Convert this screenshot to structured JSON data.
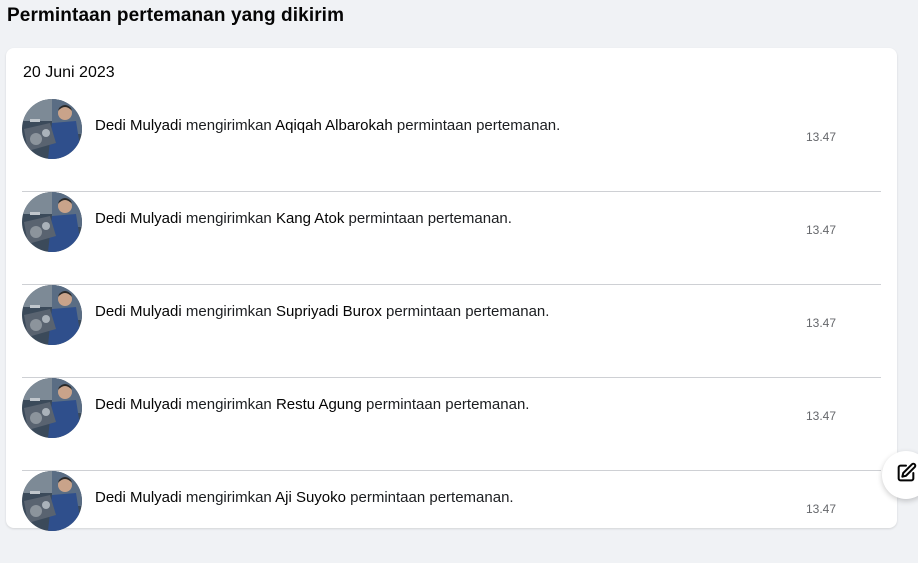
{
  "page": {
    "title": "Permintaan pertemanan yang dikirim"
  },
  "section": {
    "date": "20 Juni 2023"
  },
  "requests": [
    {
      "sender": "Dedi Mulyadi",
      "verb": "mengirimkan",
      "recipient": "Aqiqah Albarokah",
      "suffix": "permintaan pertemanan.",
      "time": "13.47"
    },
    {
      "sender": "Dedi Mulyadi",
      "verb": "mengirimkan",
      "recipient": "Kang Atok",
      "suffix": "permintaan pertemanan.",
      "time": "13.47"
    },
    {
      "sender": "Dedi Mulyadi",
      "verb": "mengirimkan",
      "recipient": "Supriyadi Burox",
      "suffix": "permintaan pertemanan.",
      "time": "13.47"
    },
    {
      "sender": "Dedi Mulyadi",
      "verb": "mengirimkan",
      "recipient": "Restu Agung",
      "suffix": "permintaan pertemanan.",
      "time": "13.47"
    },
    {
      "sender": "Dedi Mulyadi",
      "verb": "mengirimkan",
      "recipient": "Aji Suyoko",
      "suffix": "permintaan pertemanan.",
      "time": "13.47"
    }
  ],
  "icons": {
    "avatar": "user-photo",
    "compose": "compose-edit-icon"
  },
  "colors": {
    "background": "#f0f2f5",
    "card": "#ffffff",
    "divider": "#ced0d4",
    "secondary_text": "#65676b"
  }
}
